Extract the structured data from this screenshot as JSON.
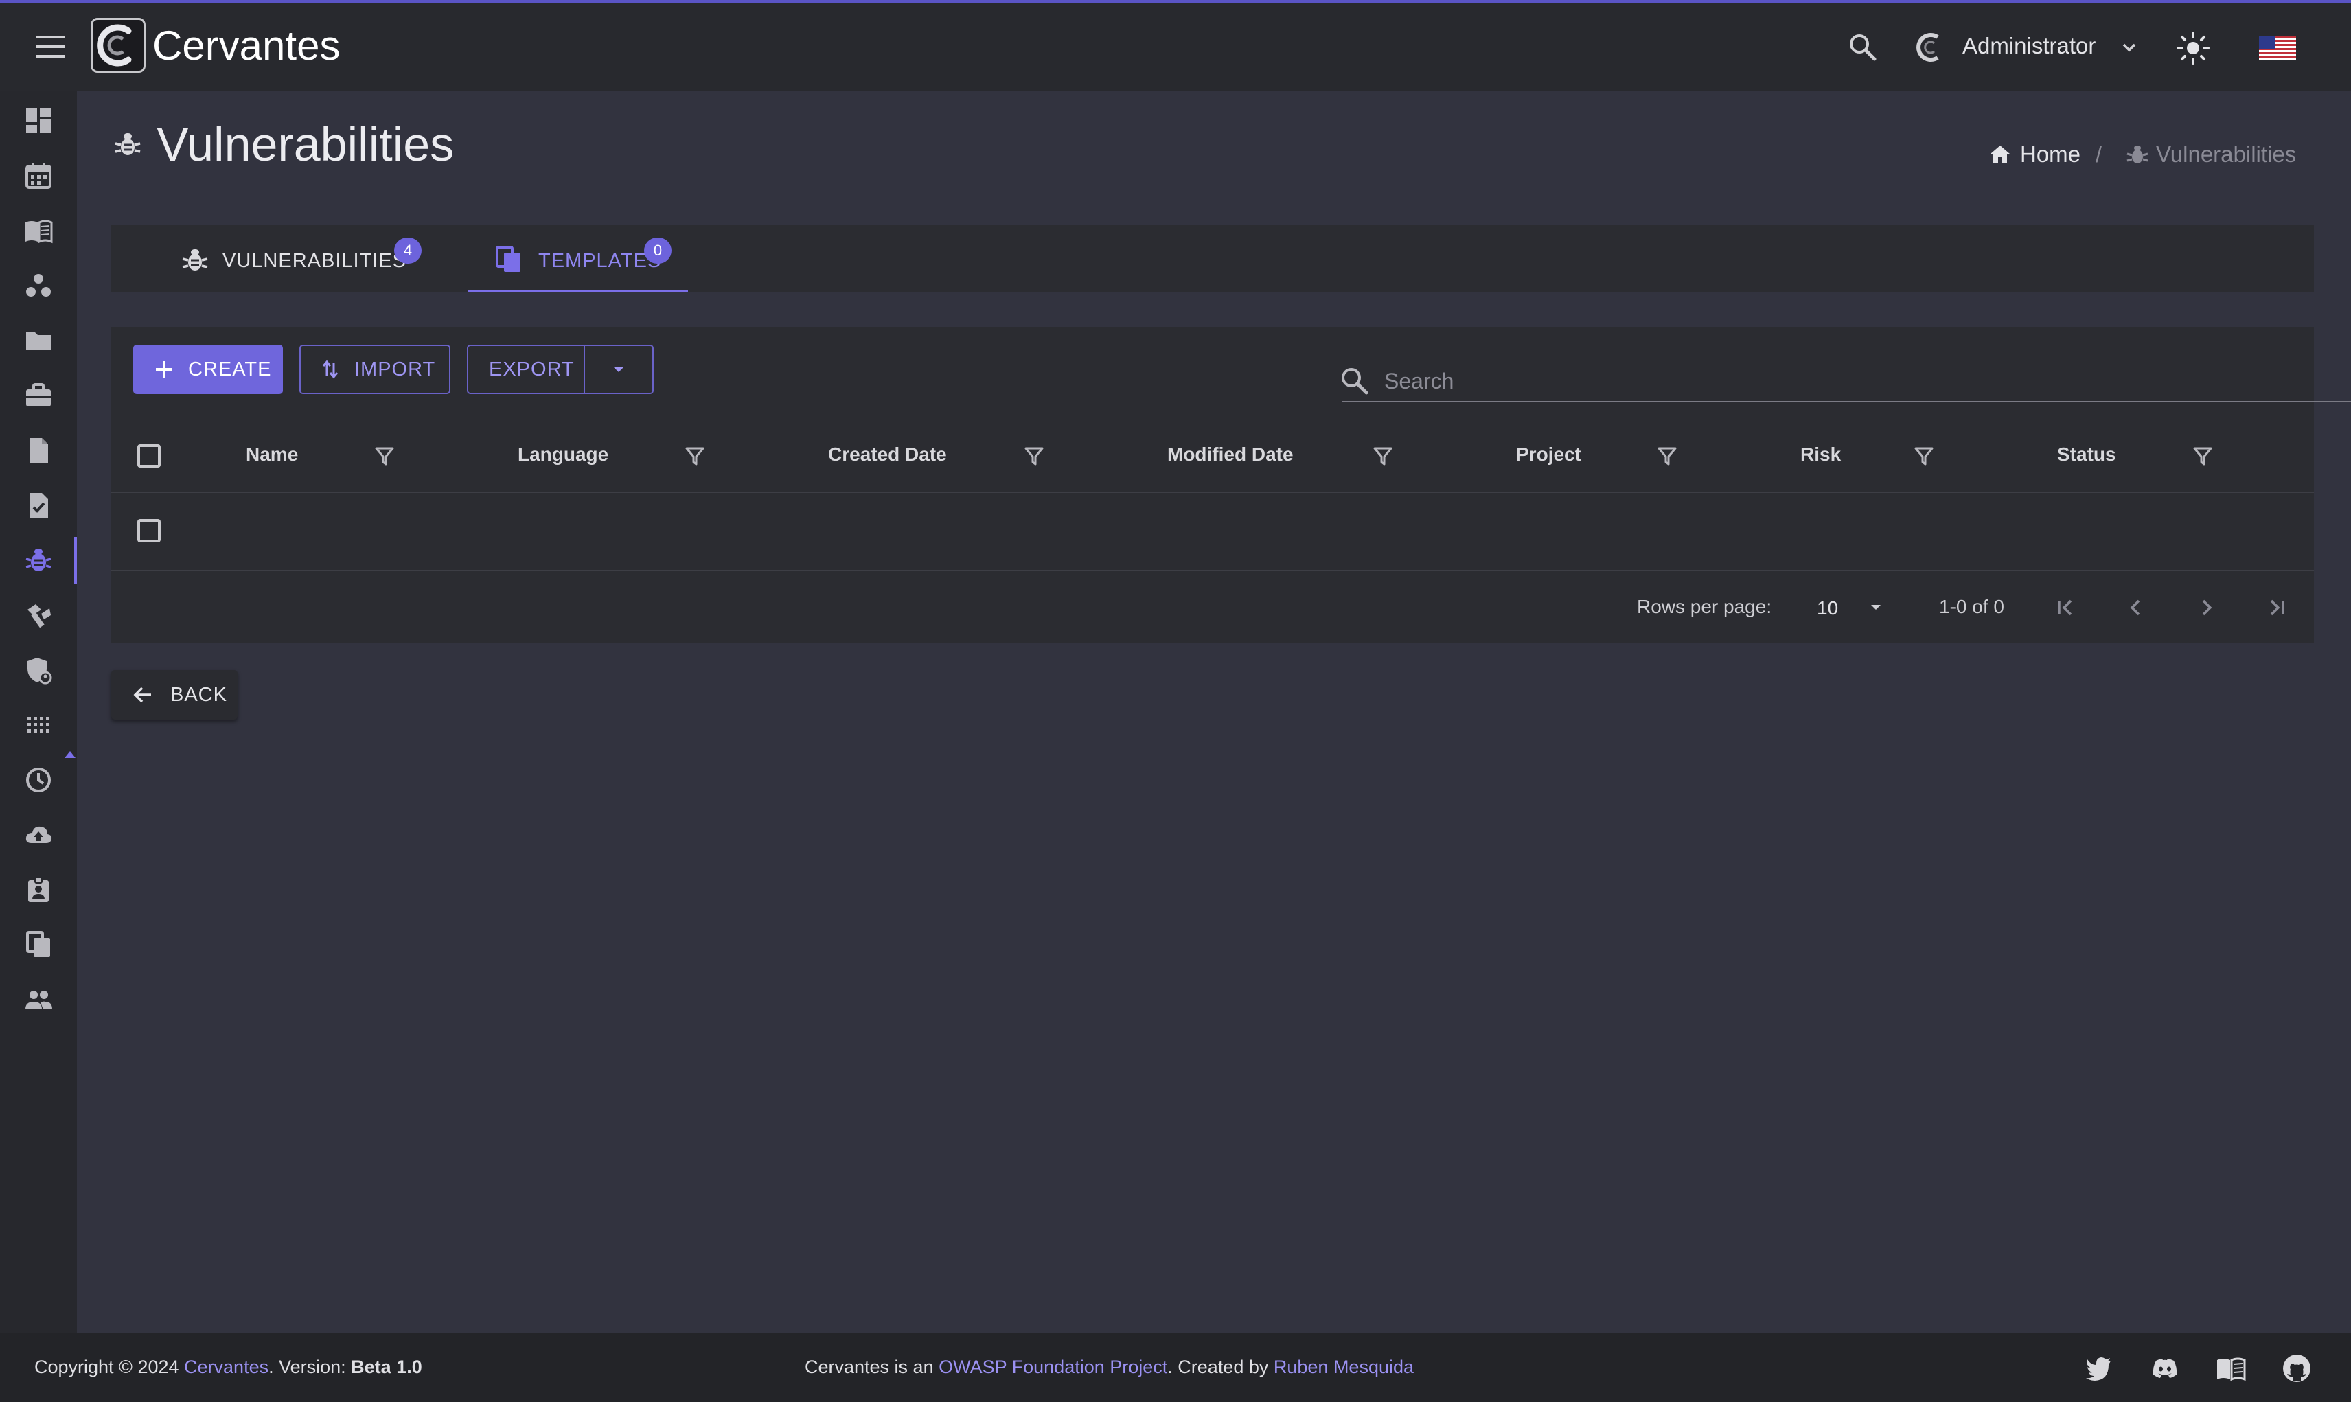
{
  "app": {
    "name": "Cervantes",
    "user": "Administrator"
  },
  "page": {
    "title": "Vulnerabilities"
  },
  "breadcrumb": {
    "home": "Home",
    "separator": "/",
    "current": "Vulnerabilities"
  },
  "tabs": [
    {
      "label": "VULNERABILITIES",
      "badge": "4",
      "active": false
    },
    {
      "label": "TEMPLATES",
      "badge": "0",
      "active": true
    }
  ],
  "toolbar": {
    "create_label": "CREATE",
    "import_label": "IMPORT",
    "export_label": "EXPORT",
    "search_placeholder": "Search"
  },
  "table": {
    "columns": [
      "Name",
      "Language",
      "Created Date",
      "Modified Date",
      "Project",
      "Risk",
      "Status"
    ],
    "rows": []
  },
  "pagination": {
    "rows_per_page_label": "Rows per page:",
    "rows_per_page_value": "10",
    "range": "1-0 of 0"
  },
  "back_label": "BACK",
  "footer": {
    "copyright": "Copyright © 2024",
    "brand": "Cervantes",
    "version_label": ". Version:",
    "version": "Beta 1.0",
    "owasp_prefix": "Cervantes is an",
    "owasp_link": "OWASP Foundation Project",
    "created_by": ". Created by",
    "author": "Ruben Mesquida"
  },
  "sidebar": {
    "icons": [
      "dashboard-icon",
      "calendar-icon",
      "book-icon",
      "clients-icon",
      "folder-icon",
      "briefcase-icon",
      "document-icon",
      "checklist-icon",
      "bug-icon",
      "tools-icon",
      "shield-icon",
      "apps-icon",
      "clock-icon",
      "cloud-upload-icon",
      "badge-icon",
      "copy-icon",
      "users-icon"
    ],
    "active": "bug-icon"
  },
  "colors": {
    "accent": "#6f66dc",
    "background": "#32333f",
    "surface": "#2b2c31",
    "topbar": "#28292e"
  }
}
